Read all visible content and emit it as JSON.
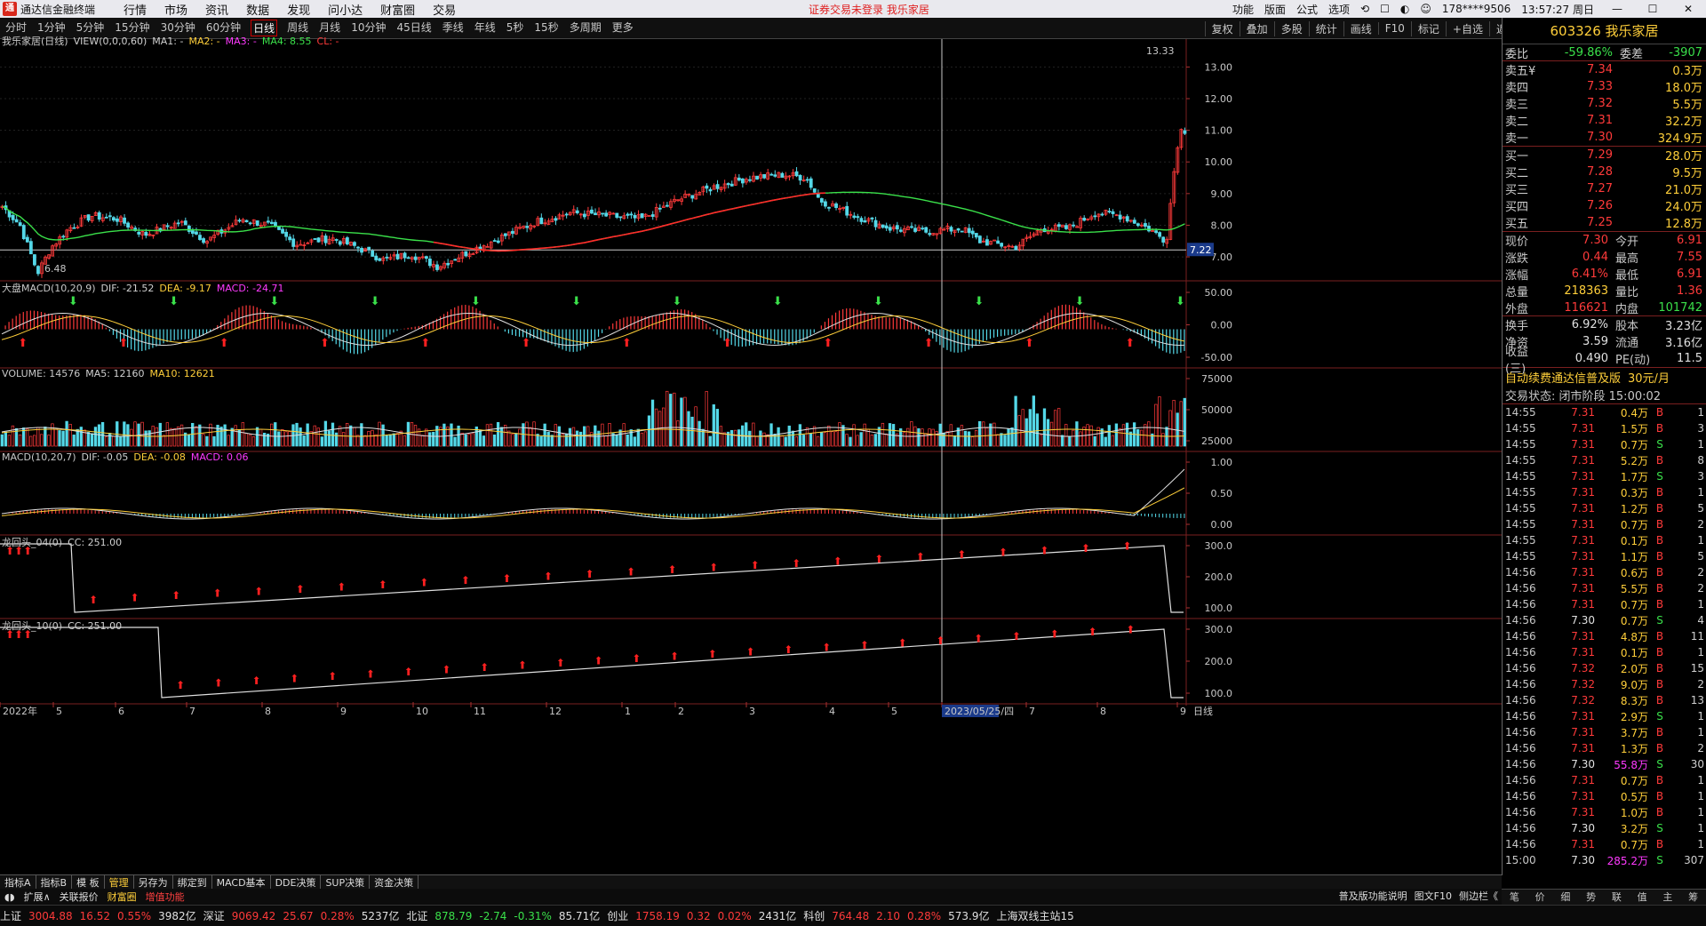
{
  "window": {
    "app_name": "通达信金融终端",
    "warning": "证券交易未登录  我乐家居",
    "account": "178****9506",
    "clock": "13:57:27 周日"
  },
  "menu": [
    "行情",
    "市场",
    "资讯",
    "数据",
    "发现",
    "问小达",
    "财富圈",
    "交易"
  ],
  "top_right_menu": [
    "功能",
    "版面",
    "公式",
    "选项"
  ],
  "periods": [
    "分时",
    "1分钟",
    "5分钟",
    "15分钟",
    "30分钟",
    "60分钟",
    "日线",
    "周线",
    "月线",
    "10分钟",
    "45日线",
    "季线",
    "年线",
    "5秒",
    "15秒",
    "多周期",
    "更多"
  ],
  "active_period": "日线",
  "right_tools": [
    "复权",
    "叠加",
    "多股",
    "统计",
    "画线",
    "F10",
    "标记",
    "+自选",
    "返回"
  ],
  "chart": {
    "title": "我乐家居(日线)",
    "ma_legend": [
      {
        "text": "VIEW(0,0,0,60)",
        "color": "#d0d0d0"
      },
      {
        "text": "MA1: -",
        "color": "#d0d0d0"
      },
      {
        "text": "MA2: -",
        "color": "#ffcf3a"
      },
      {
        "text": "MA3: -",
        "color": "#ff3aff"
      },
      {
        "text": "MA4: 8.55",
        "color": "#3ae04a"
      },
      {
        "text": "CL: -",
        "color": "#ff3a3a"
      }
    ],
    "price_axis": [
      "13.00",
      "12.00",
      "11.00",
      "10.00",
      "9.00",
      "8.00",
      "7.00"
    ],
    "max_label": "13.33",
    "min_label": "6.48",
    "current_price_tag": "7.22",
    "panels": [
      {
        "label": "大盘MACD(10,20,9)",
        "items": [
          {
            "t": "DIF: -21.52",
            "c": "#d0d0d0"
          },
          {
            "t": "DEA: -9.17",
            "c": "#ffcf3a"
          },
          {
            "t": "MACD: -24.71",
            "c": "#ff3aff"
          }
        ],
        "axis": [
          "50.00",
          "0.00",
          "-50.00"
        ]
      },
      {
        "label": "VOLUME: 14576",
        "items": [
          {
            "t": "MA5: 12160",
            "c": "#d0d0d0"
          },
          {
            "t": "MA10: 12621",
            "c": "#ffcf3a"
          }
        ],
        "axis": [
          "75000",
          "50000",
          "25000"
        ]
      },
      {
        "label": "MACD(10,20,7)",
        "items": [
          {
            "t": "DIF: -0.05",
            "c": "#d0d0d0"
          },
          {
            "t": "DEA: -0.08",
            "c": "#ffcf3a"
          },
          {
            "t": "MACD: 0.06",
            "c": "#ff3aff"
          }
        ],
        "axis": [
          "1.00",
          "0.50",
          "0.00"
        ]
      },
      {
        "label": "龙回头_04(0)",
        "items": [
          {
            "t": "CC: 251.00",
            "c": "#d0d0d0"
          }
        ],
        "axis": [
          "300.0",
          "200.0",
          "100.0"
        ]
      },
      {
        "label": "龙回头_10(0)",
        "items": [
          {
            "t": "CC: 251.00",
            "c": "#d0d0d0"
          }
        ],
        "axis": [
          "300.0",
          "200.0",
          "100.0"
        ]
      }
    ],
    "date_axis": [
      "2022年",
      "5",
      "6",
      "7",
      "8",
      "9",
      "10",
      "11",
      "12",
      "1",
      "2",
      "3",
      "4",
      "5",
      "2023/05/25/四",
      "7",
      "8",
      "9"
    ],
    "daily_label": "日线"
  },
  "quote": {
    "code_name": "603326 我乐家居",
    "weibi": {
      "label": "委比",
      "value": "-59.86%",
      "label2": "委差",
      "value2": "-3907"
    },
    "asks": [
      {
        "label": "卖五¥",
        "price": "7.34",
        "vol": "0.3万"
      },
      {
        "label": "卖四",
        "price": "7.33",
        "vol": "18.0万"
      },
      {
        "label": "卖三",
        "price": "7.32",
        "vol": "5.5万"
      },
      {
        "label": "卖二",
        "price": "7.31",
        "vol": "32.2万"
      },
      {
        "label": "卖一",
        "price": "7.30",
        "vol": "324.9万"
      }
    ],
    "bids": [
      {
        "label": "买一",
        "price": "7.29",
        "vol": "28.0万"
      },
      {
        "label": "买二",
        "price": "7.28",
        "vol": "9.5万"
      },
      {
        "label": "买三",
        "price": "7.27",
        "vol": "21.0万"
      },
      {
        "label": "买四",
        "price": "7.26",
        "vol": "24.0万"
      },
      {
        "label": "买五",
        "price": "7.25",
        "vol": "12.8万"
      }
    ],
    "stats": [
      {
        "k": "现价",
        "v": "7.30",
        "vc": "#ff3a3a",
        "k2": "今开",
        "v2": "6.91",
        "v2c": "#ff3a3a"
      },
      {
        "k": "涨跌",
        "v": "0.44",
        "vc": "#ff3a3a",
        "k2": "最高",
        "v2": "7.55",
        "v2c": "#ff3a3a"
      },
      {
        "k": "涨幅",
        "v": "6.41%",
        "vc": "#ff3a3a",
        "k2": "最低",
        "v2": "6.91",
        "v2c": "#ff3a3a"
      },
      {
        "k": "总量",
        "v": "218363",
        "vc": "#ffcf3a",
        "k2": "量比",
        "v2": "1.36",
        "v2c": "#ff3a3a"
      },
      {
        "k": "外盘",
        "v": "116621",
        "vc": "#ff3a3a",
        "k2": "内盘",
        "v2": "101742",
        "v2c": "#3ae04a"
      },
      {
        "k": "换手",
        "v": "6.92%",
        "vc": "#e0e0e0",
        "k2": "股本",
        "v2": "3.23亿",
        "v2c": "#e0e0e0"
      },
      {
        "k": "净资",
        "v": "3.59",
        "vc": "#e0e0e0",
        "k2": "流通",
        "v2": "3.16亿",
        "v2c": "#e0e0e0"
      },
      {
        "k": "收益(三)",
        "v": "0.490",
        "vc": "#e0e0e0",
        "k2": "PE(动)",
        "v2": "11.5",
        "v2c": "#e0e0e0"
      }
    ],
    "ad": {
      "text": "自动续费通达信普及版",
      "price": "30元/月"
    },
    "trade_status": "交易状态: 闭市阶段 15:00:02",
    "ticks": [
      [
        "14:55",
        "7.31",
        "0.4万",
        "B",
        "1"
      ],
      [
        "14:55",
        "7.31",
        "1.5万",
        "B",
        "3"
      ],
      [
        "14:55",
        "7.31",
        "0.7万",
        "S",
        "1"
      ],
      [
        "14:55",
        "7.31",
        "5.2万",
        "B",
        "8"
      ],
      [
        "14:55",
        "7.31",
        "1.7万",
        "S",
        "3"
      ],
      [
        "14:55",
        "7.31",
        "0.3万",
        "B",
        "1"
      ],
      [
        "14:55",
        "7.31",
        "1.2万",
        "B",
        "5"
      ],
      [
        "14:55",
        "7.31",
        "0.7万",
        "B",
        "2"
      ],
      [
        "14:55",
        "7.31",
        "0.1万",
        "B",
        "1"
      ],
      [
        "14:55",
        "7.31",
        "1.1万",
        "B",
        "5"
      ],
      [
        "14:56",
        "7.31",
        "0.6万",
        "B",
        "2"
      ],
      [
        "14:56",
        "7.31",
        "5.5万",
        "B",
        "2"
      ],
      [
        "14:56",
        "7.31",
        "0.7万",
        "B",
        "1"
      ],
      [
        "14:56",
        "7.30",
        "0.7万",
        "S",
        "4"
      ],
      [
        "14:56",
        "7.31",
        "4.8万",
        "B",
        "11"
      ],
      [
        "14:56",
        "7.31",
        "0.1万",
        "B",
        "1"
      ],
      [
        "14:56",
        "7.32",
        "2.0万",
        "B",
        "15"
      ],
      [
        "14:56",
        "7.32",
        "9.0万",
        "B",
        "2"
      ],
      [
        "14:56",
        "7.32",
        "8.3万",
        "B",
        "13"
      ],
      [
        "14:56",
        "7.31",
        "2.9万",
        "S",
        "1"
      ],
      [
        "14:56",
        "7.31",
        "3.7万",
        "B",
        "1"
      ],
      [
        "14:56",
        "7.31",
        "1.3万",
        "B",
        "2"
      ],
      [
        "14:56",
        "7.30",
        "55.8万",
        "S",
        "30"
      ],
      [
        "14:56",
        "7.31",
        "0.7万",
        "B",
        "1"
      ],
      [
        "14:56",
        "7.31",
        "0.5万",
        "B",
        "1"
      ],
      [
        "14:56",
        "7.31",
        "1.0万",
        "B",
        "1"
      ],
      [
        "14:56",
        "7.30",
        "3.2万",
        "S",
        "1"
      ],
      [
        "14:56",
        "7.31",
        "0.7万",
        "B",
        "1"
      ],
      [
        "15:00",
        "7.30",
        "285.2万",
        "S",
        "307"
      ]
    ],
    "side_tabs": [
      "笔",
      "价",
      "细",
      "势",
      "联",
      "值",
      "主",
      "筹"
    ]
  },
  "bottom_tabs": [
    "指标A",
    "指标B",
    "模 板",
    "管理",
    "另存为",
    "绑定到",
    "MACD基本",
    "DDE决策",
    "SUP决策",
    "资金决策"
  ],
  "bottom_active": "管理",
  "strip": {
    "expand": "扩展∧",
    "related": "关联报价",
    "wealth": "财富圈",
    "extra": "增值功能",
    "right": [
      "普及版功能说明",
      "图文F10",
      "侧边栏《"
    ]
  },
  "status": [
    {
      "t": "上证",
      "c": "w"
    },
    {
      "t": "3004.88",
      "c": "up"
    },
    {
      "t": "16.52",
      "c": "up"
    },
    {
      "t": "0.55%",
      "c": "up"
    },
    {
      "t": "3982亿",
      "c": "w"
    },
    {
      "t": "深证",
      "c": "w"
    },
    {
      "t": "9069.42",
      "c": "up"
    },
    {
      "t": "25.67",
      "c": "up"
    },
    {
      "t": "0.28%",
      "c": "up"
    },
    {
      "t": "5237亿",
      "c": "w"
    },
    {
      "t": "北证",
      "c": "w"
    },
    {
      "t": "878.79",
      "c": "dn"
    },
    {
      "t": "-2.74",
      "c": "dn"
    },
    {
      "t": "-0.31%",
      "c": "dn"
    },
    {
      "t": "85.71亿",
      "c": "w"
    },
    {
      "t": "创业",
      "c": "w"
    },
    {
      "t": "1758.19",
      "c": "up"
    },
    {
      "t": "0.32",
      "c": "up"
    },
    {
      "t": "0.02%",
      "c": "up"
    },
    {
      "t": "2431亿",
      "c": "w"
    },
    {
      "t": "科创",
      "c": "w"
    },
    {
      "t": "764.48",
      "c": "up"
    },
    {
      "t": "2.10",
      "c": "up"
    },
    {
      "t": "0.28%",
      "c": "up"
    },
    {
      "t": "573.9亿",
      "c": "w"
    },
    {
      "t": "上海双线主站15",
      "c": "w"
    }
  ]
}
